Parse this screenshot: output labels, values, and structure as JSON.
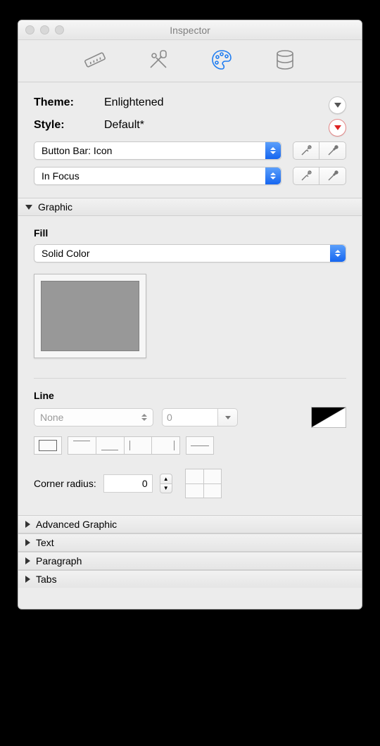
{
  "window": {
    "title": "Inspector"
  },
  "toolbar_icons": [
    "ruler-icon",
    "tools-icon",
    "palette-icon",
    "database-icon"
  ],
  "active_toolbar_index": 2,
  "theme": {
    "label": "Theme:",
    "value": "Enlightened"
  },
  "style": {
    "label": "Style:",
    "value": "Default*"
  },
  "style_part_popup": "Button Bar: Icon",
  "state_popup": "In Focus",
  "sections": {
    "graphic": {
      "title": "Graphic",
      "expanded": true
    },
    "advanced_graphic": {
      "title": "Advanced Graphic",
      "expanded": false
    },
    "text": {
      "title": "Text",
      "expanded": false
    },
    "paragraph": {
      "title": "Paragraph",
      "expanded": false
    },
    "tabs": {
      "title": "Tabs",
      "expanded": false
    }
  },
  "graphic": {
    "fill_label": "Fill",
    "fill_type": "Solid Color",
    "fill_color": "#989898",
    "line_label": "Line",
    "line_style": "None",
    "line_width": "0",
    "corner_radius_label": "Corner radius:",
    "corner_radius": "0"
  }
}
